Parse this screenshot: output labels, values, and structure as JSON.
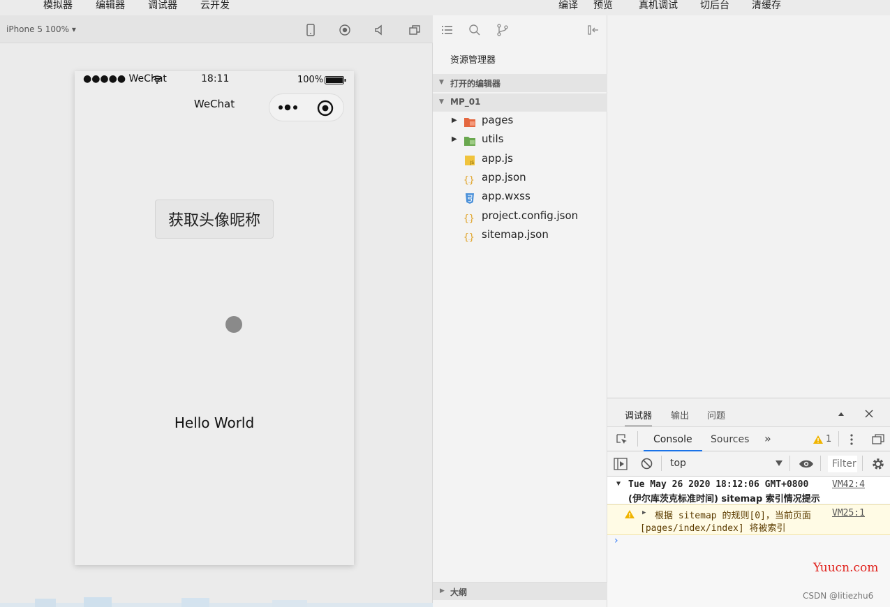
{
  "menu": {
    "left": [
      "模拟器",
      "编辑器",
      "调试器",
      "云开发"
    ],
    "right": [
      "编译",
      "预览",
      "真机调试",
      "切后台",
      "清缓存"
    ]
  },
  "simulator": {
    "device_label": "iPhone 5 100% ▾",
    "status_bar": {
      "carrier": "●●●●● WeChat",
      "time": "18:11",
      "battery": "100%"
    },
    "nav_title": "WeChat",
    "get_profile_button": "获取头像昵称",
    "hello_text": "Hello World"
  },
  "explorer": {
    "title": "资源管理器",
    "open_editors": "打开的编辑器",
    "project": "MP_01",
    "files": [
      {
        "name": "pages",
        "icon": "folder-pages-icon",
        "expandable": true
      },
      {
        "name": "utils",
        "icon": "folder-utils-icon",
        "expandable": true
      },
      {
        "name": "app.js",
        "icon": "js-file-icon",
        "expandable": false
      },
      {
        "name": "app.json",
        "icon": "json-file-icon",
        "expandable": false
      },
      {
        "name": "app.wxss",
        "icon": "css-file-icon",
        "expandable": false
      },
      {
        "name": "project.config.json",
        "icon": "json-file-icon",
        "expandable": false
      },
      {
        "name": "sitemap.json",
        "icon": "json-file-icon",
        "expandable": false
      }
    ],
    "outline": "大纲"
  },
  "devtools": {
    "tabs": [
      "调试器",
      "输出",
      "问题"
    ],
    "panel_tabs": {
      "console": "Console",
      "sources": "Sources",
      "more": "»"
    },
    "warning_count": "1",
    "context": "top",
    "filter_placeholder": "Filter",
    "log1": {
      "line1": "Tue May 26 2020 18:12:06 GMT+0800",
      "line2": "(伊尔库茨克标准时间) sitemap 索引情况提示",
      "source": "VM42:4"
    },
    "log2": {
      "line1": "根据 sitemap 的规则[0]，当前页面",
      "line2": "[pages/index/index] 将被索引",
      "source": "VM25:1"
    },
    "prompt": "›"
  },
  "watermarks": {
    "site": "Yuucn.com",
    "author": "CSDN @litiezhu6"
  }
}
